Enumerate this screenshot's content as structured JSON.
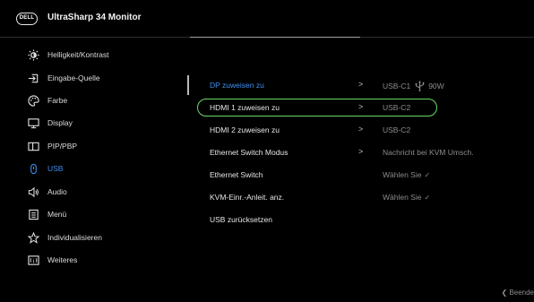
{
  "header": {
    "logo": "DELL",
    "title": "UltraSharp 34 Monitor"
  },
  "sidebar": {
    "items": [
      {
        "label": "Helligkeit/Kontrast",
        "icon": "brightness-icon"
      },
      {
        "label": "Eingabe-Quelle",
        "icon": "input-source-icon"
      },
      {
        "label": "Farbe",
        "icon": "color-palette-icon"
      },
      {
        "label": "Display",
        "icon": "display-icon"
      },
      {
        "label": "PIP/PBP",
        "icon": "pip-pbp-icon"
      },
      {
        "label": "USB",
        "icon": "usb-power-icon",
        "active": true
      },
      {
        "label": "Audio",
        "icon": "audio-icon"
      },
      {
        "label": "Menü",
        "icon": "menu-icon"
      },
      {
        "label": "Individualisieren",
        "icon": "star-icon"
      },
      {
        "label": "Weiteres",
        "icon": "info-icon"
      }
    ]
  },
  "main": {
    "rows": [
      {
        "label": "DP zuweisen zu",
        "arrow": ">",
        "value": "USB-C1",
        "value_suffix": "90W",
        "selected": true
      },
      {
        "label": "HDMI 1 zuweisen zu",
        "arrow": ">",
        "value": "USB-C2",
        "focused": true
      },
      {
        "label": "HDMI 2 zuweisen zu",
        "arrow": ">",
        "value": "USB-C2"
      },
      {
        "label": "Ethernet Switch Modus",
        "arrow": ">",
        "value": "Nachricht bei KVM Umsch."
      },
      {
        "label": "Ethernet Switch",
        "arrow": "",
        "value": "Wählen Sie",
        "check": "✓"
      },
      {
        "label": "KVM-Einr.-Anleit. anz.",
        "arrow": "",
        "value": "Wählen Sie",
        "check": "✓"
      },
      {
        "label": "USB zurücksetzen",
        "arrow": "",
        "value": ""
      }
    ]
  },
  "footer": {
    "exit": "❮ Beende"
  },
  "colors": {
    "background": "#000000",
    "accent_blue": "#3d8ef0",
    "focus_green": "#6ad86a",
    "value_gray": "#8c8c8c"
  }
}
